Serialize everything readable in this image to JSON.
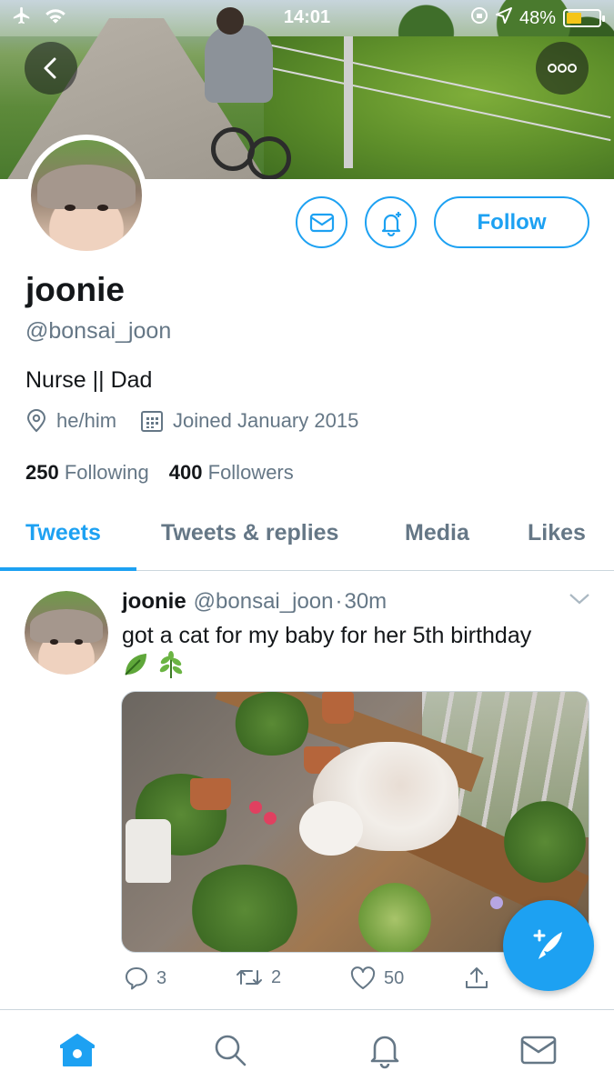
{
  "status_bar": {
    "time": "14:01",
    "battery": "48%"
  },
  "profile": {
    "name": "joonie",
    "handle": "@bonsai_joon",
    "bio": "Nurse || Dad",
    "pronouns": "he/him",
    "joined": "Joined January 2015",
    "following_count": "250",
    "following_label": "Following",
    "followers_count": "400",
    "followers_label": "Followers",
    "follow_label": "Follow"
  },
  "tabs": [
    {
      "label": "Tweets",
      "active": true
    },
    {
      "label": "Tweets & replies",
      "active": false
    },
    {
      "label": "Media",
      "active": false
    },
    {
      "label": "Likes",
      "active": false
    }
  ],
  "tweet": {
    "name": "joonie",
    "handle": "@bonsai_joon",
    "separator": "·",
    "time": "30m",
    "text": "got a cat for my baby for her 5th birthday",
    "emojis": [
      "leaf-icon",
      "herb-icon"
    ],
    "replies": "3",
    "retweets": "2",
    "likes": "50"
  },
  "colors": {
    "accent": "#1da1f2",
    "secondary_text": "#657786",
    "divider": "#ccd6dd",
    "battery": "#f5c518"
  },
  "icons": {
    "nav": [
      "home-icon",
      "search-icon",
      "notifications-icon",
      "messages-icon"
    ],
    "compose": "compose-tweet-icon"
  }
}
